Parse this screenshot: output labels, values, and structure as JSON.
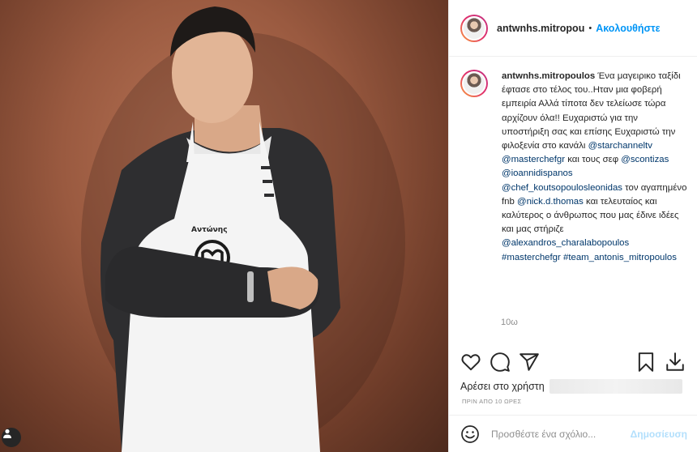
{
  "post": {
    "username": "antwnhs.mitropou",
    "follow_label": "Ακολουθήστε",
    "dot": "•"
  },
  "caption": {
    "username": "antwnhs.mitropoulos",
    "parts": [
      {
        "type": "text",
        "value": " Ένα μαγειρικο ταξίδι έφτασε στο τέλος του..Ηταν μια φοβερή εμπειρία Αλλά τίποτα δεν τελείωσε τώρα αρχίζουν όλα!! Ευχαριστώ για την υποστήριξη σας και επίσης Ευχαριστώ την φιλοξενία στο κανάλι "
      },
      {
        "type": "link",
        "value": "@starchanneltv"
      },
      {
        "type": "text",
        "value": " "
      },
      {
        "type": "link",
        "value": "@masterchefgr"
      },
      {
        "type": "text",
        "value": " και τους σεφ "
      },
      {
        "type": "link",
        "value": "@scontizas"
      },
      {
        "type": "text",
        "value": " "
      },
      {
        "type": "link",
        "value": "@ioannidispanos"
      },
      {
        "type": "text",
        "value": " "
      },
      {
        "type": "link",
        "value": "@chef_koutsopoulosleonidas"
      },
      {
        "type": "text",
        "value": " τον αγαπημένο fnb "
      },
      {
        "type": "link",
        "value": "@nick.d.thomas"
      },
      {
        "type": "text",
        "value": " και τελευταίος και καλύτερος ο άνθρωπος που μας έδινε ιδέες και μας στήριζε "
      },
      {
        "type": "link",
        "value": "@alexandros_charalabopoulos"
      },
      {
        "type": "text",
        "value": " "
      },
      {
        "type": "link",
        "value": "#masterchefgr"
      },
      {
        "type": "text",
        "value": " "
      },
      {
        "type": "link",
        "value": "#team_antonis_mitropoulos"
      }
    ],
    "time": "10ω"
  },
  "apron": {
    "name": "Αντώνης"
  },
  "likes": {
    "label": "Αρέσει στο χρήστη"
  },
  "timestamp": "ΠΡΙΝ ΑΠΟ 10 ΩΡΕΣ",
  "comment": {
    "placeholder": "Προσθέστε ένα σχόλιο...",
    "publish_label": "Δημοσίευση"
  },
  "icons": {
    "like": "heart-icon",
    "comment": "comment-icon",
    "share": "share-icon",
    "save": "bookmark-icon",
    "download": "download-icon",
    "emoji": "emoji-icon",
    "tag": "user-tag-icon"
  },
  "colors": {
    "link": "#00376b",
    "follow": "#0095f6",
    "publish_disabled": "#b2dffc",
    "muted": "#8e8e8e"
  }
}
